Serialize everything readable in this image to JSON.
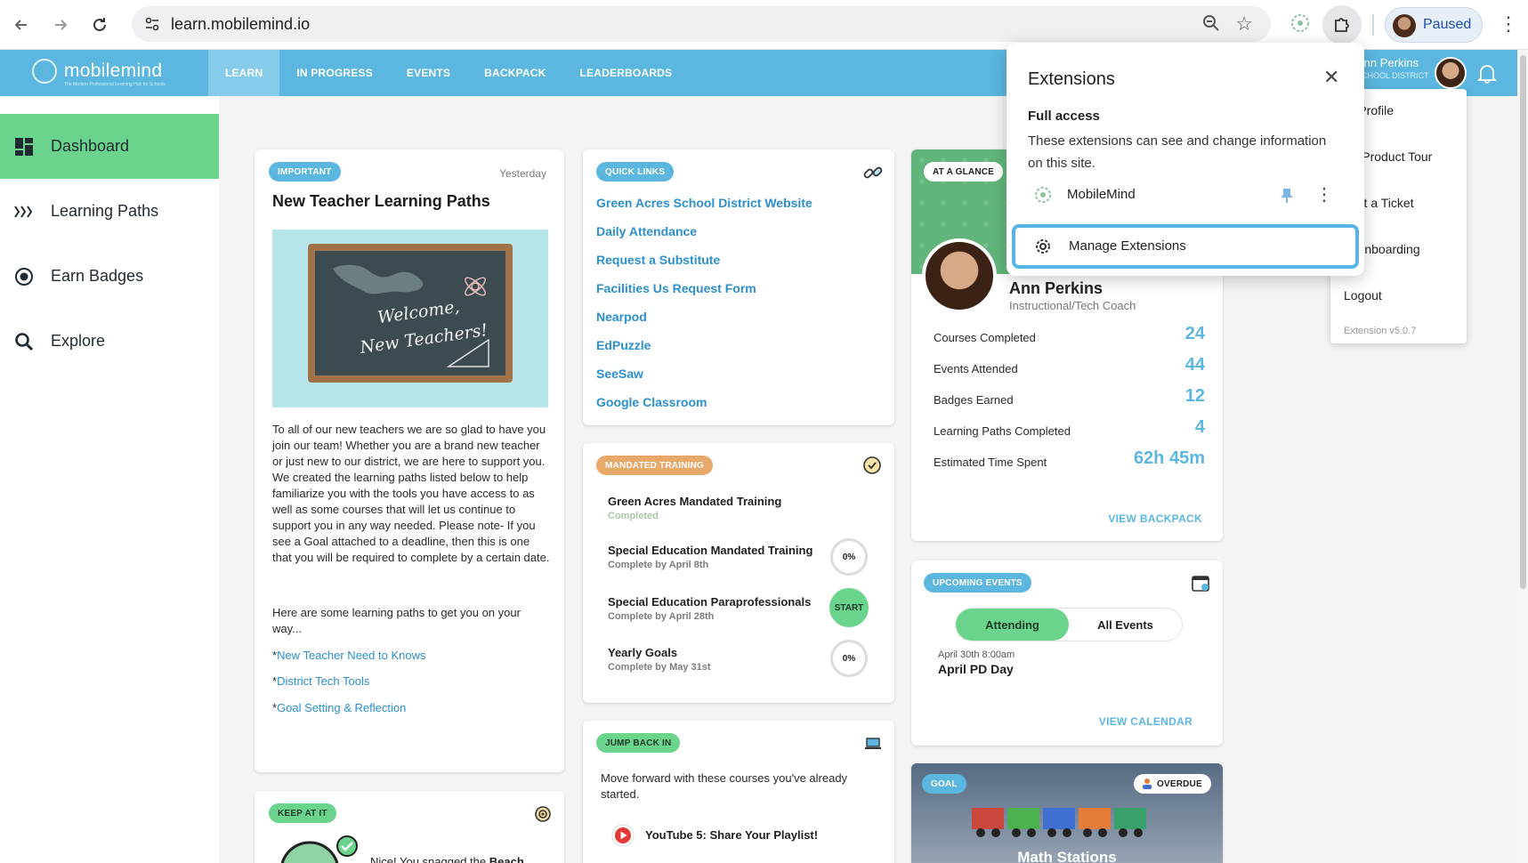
{
  "browser": {
    "url": "learn.mobilemind.io",
    "profile_label": "Paused"
  },
  "app": {
    "logo_text": "mobilemind",
    "logo_tagline": "The Modern Professional Learning Hub for Schools",
    "nav": [
      "LEARN",
      "IN PROGRESS",
      "EVENTS",
      "BACKPACK",
      "LEADERBOARDS"
    ],
    "active_nav": "LEARN",
    "user_name": "Ann Perkins",
    "user_org": "SCHOOL DISTRICT"
  },
  "sidebar": {
    "items": [
      {
        "label": "Dashboard",
        "icon": "dashboard-icon"
      },
      {
        "label": "Learning Paths",
        "icon": "paths-icon"
      },
      {
        "label": "Earn Badges",
        "icon": "badge-icon"
      },
      {
        "label": "Explore",
        "icon": "search-icon"
      }
    ]
  },
  "important": {
    "pill": "IMPORTANT",
    "date": "Yesterday",
    "title": "New Teacher Learning Paths",
    "board_line1": "Welcome,",
    "board_line2": "New Teachers!",
    "paragraph": "To all of our new teachers we are so glad to have you join our team! Whether you are a brand new teacher or just new to our district, we are here to support you. We created the learning paths listed below to help familiarize you with the tools you have access to as well as some courses that will let us continue to support you in any way needed. Please note- If you see a Goal attached to a deadline, then this is one that you will be required to complete by a certain date.",
    "intro": "Here are some learning paths to get you on your way...",
    "bullet": "*",
    "links": [
      "New Teacher Need to Knows",
      "District Tech Tools",
      "Goal Setting & Reflection"
    ]
  },
  "keep_at_it": {
    "pill": "KEEP AT IT",
    "text_prefix": "Nice! You snagged the ",
    "text_bold": "Beach"
  },
  "quick_links": {
    "pill": "QUICK LINKS",
    "items": [
      "Green Acres School District Website",
      "Daily Attendance",
      "Request a Substitute",
      "Facilities Us Request Form",
      "Nearpod",
      "EdPuzzle",
      "SeeSaw",
      "Google Classroom"
    ]
  },
  "training": {
    "pill": "MANDATED TRAINING",
    "items": [
      {
        "name": "Green Acres Mandated Training",
        "status": "Completed"
      },
      {
        "name": "Special Education Mandated Training",
        "status": "Complete by April 8th",
        "badge": "0%"
      },
      {
        "name": "Special Education Paraprofessionals",
        "status": "Complete by April 28th",
        "badge": "START"
      },
      {
        "name": "Yearly Goals",
        "status": "Complete by May 31st",
        "badge": "0%"
      }
    ]
  },
  "jump_back": {
    "pill": "JUMP BACK IN",
    "text": "Move forward with these courses you've already started.",
    "course": "YouTube 5: Share Your Playlist!"
  },
  "glance": {
    "pill": "AT A GLANCE",
    "name": "Ann Perkins",
    "role": "Instructional/Tech Coach",
    "stats": [
      {
        "label": "Courses Completed",
        "value": "24"
      },
      {
        "label": "Events Attended",
        "value": "44"
      },
      {
        "label": "Badges Earned",
        "value": "12"
      },
      {
        "label": "Learning Paths Completed",
        "value": "4"
      },
      {
        "label": "Estimated Time Spent",
        "value": "62h 45m"
      }
    ],
    "cta": "VIEW BACKPACK"
  },
  "events": {
    "pill": "UPCOMING EVENTS",
    "tabs": [
      "Attending",
      "All Events"
    ],
    "event_date": "April 30th 8:00am",
    "event_name": "April PD Day",
    "cta": "VIEW CALENDAR"
  },
  "goal": {
    "pill": "GOAL",
    "badge": "OVERDUE",
    "title": "Math Stations"
  },
  "extensions_popup": {
    "title": "Extensions",
    "full_access": "Full access",
    "description": "These extensions can see and change information on this site.",
    "extension_name": "MobileMind",
    "manage": "Manage Extensions"
  },
  "profile_menu": {
    "items": [
      "ur Profile",
      "art Product Tour",
      "bmit a Ticket",
      "rt Onboarding",
      "Logout"
    ],
    "version": "Extension v5.0.7"
  },
  "colors": {
    "brand_blue": "#5bb7e0",
    "brand_green": "#6bd48c",
    "link_blue": "#2b8fd0",
    "training_orange": "#e8a86a"
  }
}
